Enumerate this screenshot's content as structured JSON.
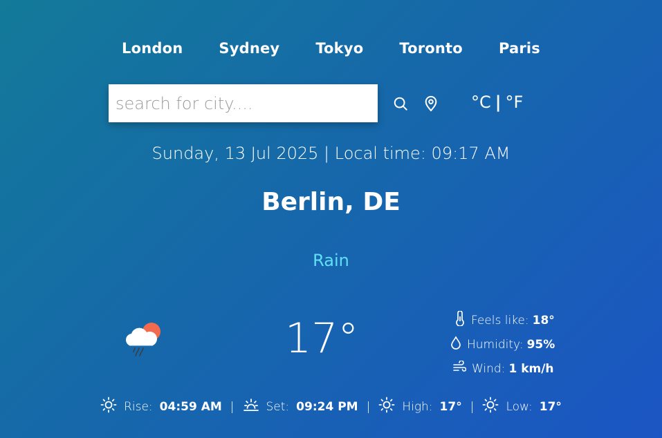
{
  "cities": [
    "London",
    "Sydney",
    "Tokyo",
    "Toronto",
    "Paris"
  ],
  "search": {
    "placeholder": "search for city...."
  },
  "units": {
    "celsius": "°C",
    "separator": "|",
    "fahrenheit": "°F"
  },
  "datetime": "Sunday, 13 Jul 2025 | Local time: 09:17 AM",
  "location": "Berlin, DE",
  "condition": "Rain",
  "temperature": "17°",
  "details": {
    "feels_like": {
      "label": "Feels like:",
      "value": "18°"
    },
    "humidity": {
      "label": "Humidity:",
      "value": "95%"
    },
    "wind": {
      "label": "Wind:",
      "value": "1 km/h"
    }
  },
  "sun": {
    "rise": {
      "label": "Rise:",
      "value": "04:59 AM"
    },
    "set": {
      "label": "Set:",
      "value": "09:24 PM"
    },
    "high": {
      "label": "High:",
      "value": "17°"
    },
    "low": {
      "label": "Low:",
      "value": "17°"
    },
    "separator": "|"
  },
  "icons": {
    "search": "search-icon",
    "location": "location-pin-icon",
    "weather": "rain-cloud-sun-icon",
    "thermometer": "thermometer-icon",
    "humidity": "droplet-icon",
    "wind": "wind-icon",
    "sun": "sun-icon",
    "sunset": "sunset-icon"
  },
  "colors": {
    "condition": "#5fe0f5",
    "bg_start": "#137a99",
    "bg_end": "#1b55c4"
  }
}
